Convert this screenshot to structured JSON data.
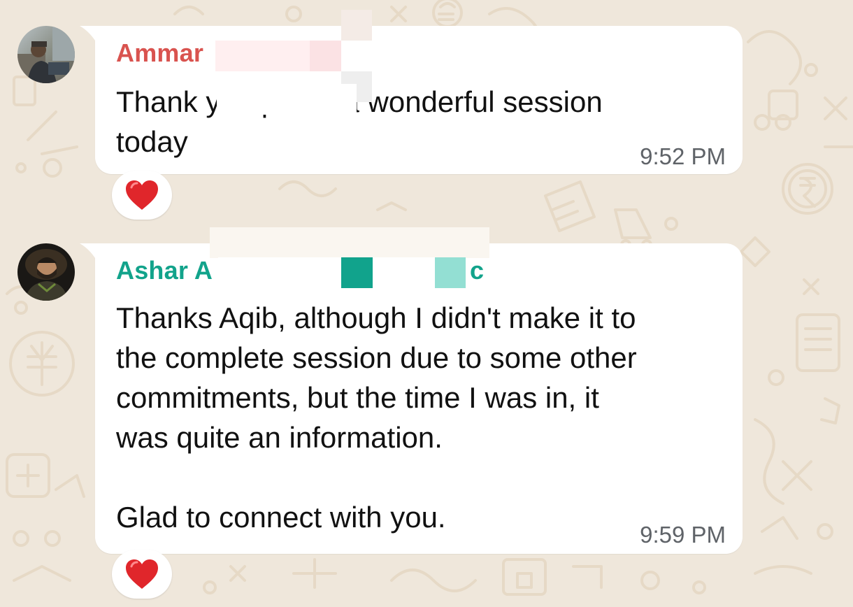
{
  "messages": [
    {
      "sender": "Ammar",
      "text": "Thank yc    ıqıb ıor a wonderful session\ntoday",
      "time": "9:52 PM",
      "reaction": "heart",
      "name_color": "#d9534f"
    },
    {
      "sender": "Ashar A",
      "sender_suffix": "c",
      "text": "Thanks Aqib, although I didn't make it to\nthe complete session due to some other\ncommitments, but the time I was in, it\nwas quite an information.\n\nGlad to connect with you.",
      "time": "9:59 PM",
      "reaction": "heart",
      "name_color": "#12a38b"
    }
  ],
  "theme": {
    "wallpaper": "#efe7db",
    "bubble": "#ffffff",
    "reaction_color": "#e0262b"
  },
  "icons": [
    "heart-icon",
    "avatar-ammar",
    "avatar-ashar"
  ]
}
